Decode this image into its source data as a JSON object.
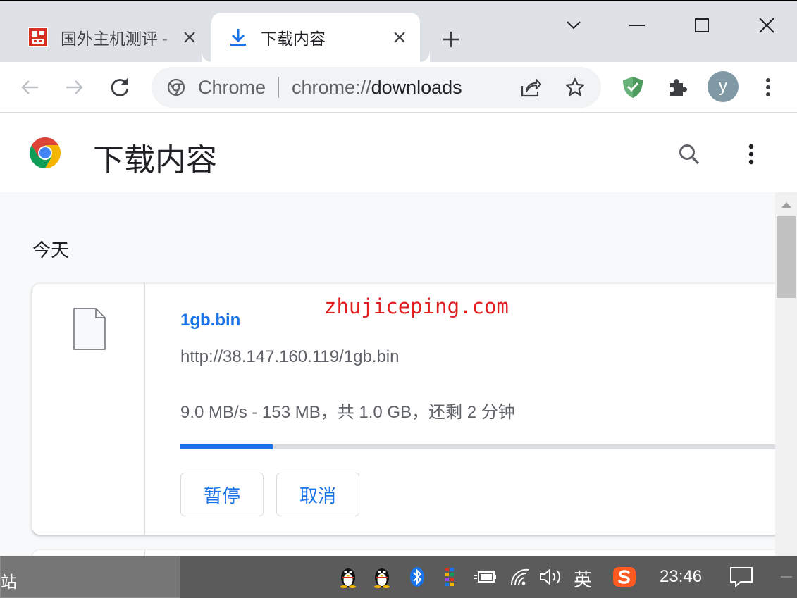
{
  "tabs": [
    {
      "title": "国外主机测评 - ",
      "icon": "site-favicon-red",
      "active": false
    },
    {
      "title": "下载内容",
      "icon": "download-icon",
      "active": true
    }
  ],
  "omnibox": {
    "chip": "Chrome",
    "url_scheme": "chrome://",
    "url_host": "downloads"
  },
  "avatar_letter": "y",
  "page": {
    "title": "下载内容"
  },
  "downloads": {
    "section_date": "今天",
    "items": [
      {
        "file_name": "1gb.bin",
        "url": "http://38.147.160.119/1gb.bin",
        "status": "9.0 MB/s - 153 MB，共 1.0 GB，还剩 2 分钟",
        "progress_percent": 15,
        "pause_label": "暂停",
        "cancel_label": "取消"
      }
    ]
  },
  "watermark": "zhujiceping.com",
  "taskbar": {
    "app_label": "站",
    "ime_label": "英",
    "clock": "23:46"
  },
  "colors": {
    "accent": "#1a73e8",
    "tabstrip": "#dee1e6",
    "watermark": "#e02020",
    "taskbar": "#5b5b5b"
  }
}
